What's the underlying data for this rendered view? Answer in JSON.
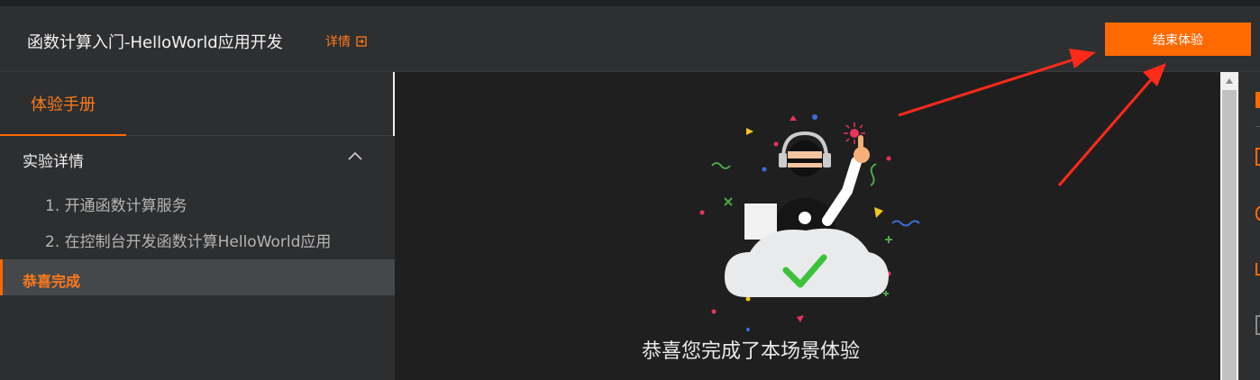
{
  "header": {
    "title": "函数计算入门-HelloWorld应用开发",
    "details_label": "详情",
    "end_button_label": "结束体验"
  },
  "sidebar": {
    "tab_label": "体验手册",
    "section_title": "实验详情",
    "steps": [
      "1. 开通函数计算服务",
      "2. 在控制台开发函数计算HelloWorld应用"
    ],
    "active_item": "恭喜完成"
  },
  "main": {
    "congrats_text": "恭喜您完成了本场景体验"
  },
  "colors": {
    "accent": "#ff6a00",
    "annotation_arrow": "#ff2a1a",
    "check": "#3cc23a"
  },
  "icons": [
    "external-link-icon",
    "chevron-up-icon",
    "checkmark-icon",
    "headset-icon",
    "arrow-up-icon"
  ]
}
